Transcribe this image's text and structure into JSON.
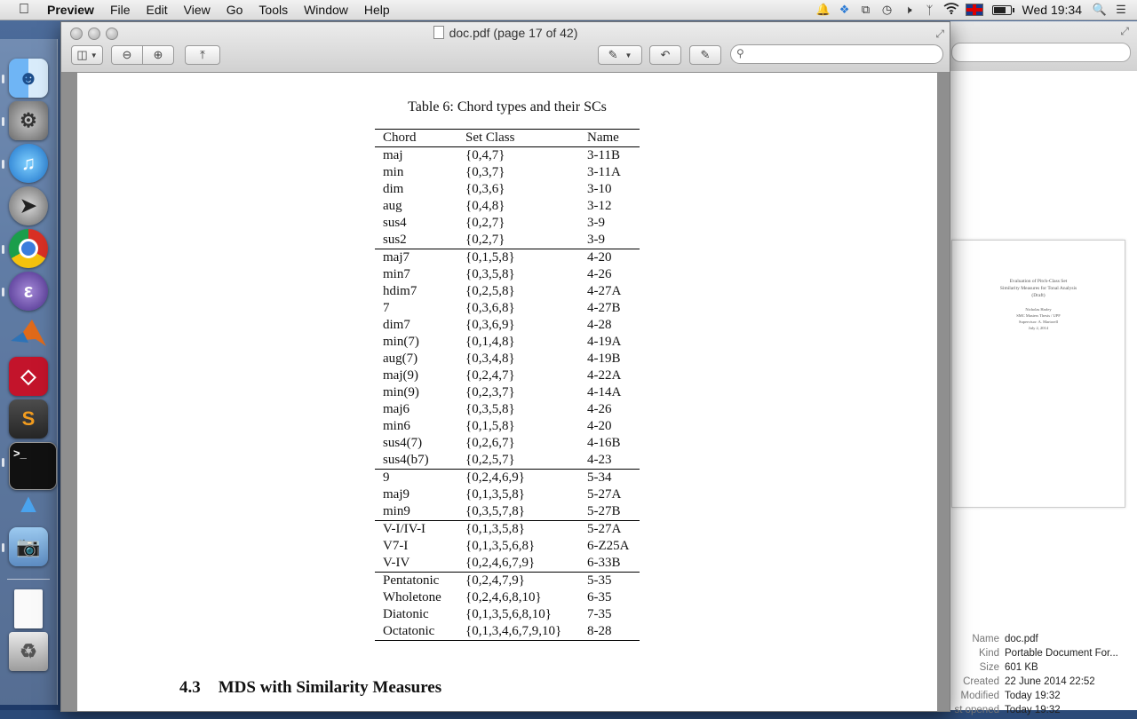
{
  "menubar": {
    "app": "Preview",
    "items": [
      "File",
      "Edit",
      "View",
      "Go",
      "Tools",
      "Window",
      "Help"
    ],
    "clock": "Wed 19:34"
  },
  "window": {
    "title": "doc.pdf (page 17 of 42)"
  },
  "document": {
    "caption": "Table 6: Chord types and their SCs",
    "headers": [
      "Chord",
      "Set Class",
      "Name"
    ],
    "groups": [
      [
        [
          "maj",
          "{0,4,7}",
          "3-11B"
        ],
        [
          "min",
          "{0,3,7}",
          "3-11A"
        ],
        [
          "dim",
          "{0,3,6}",
          "3-10"
        ],
        [
          "aug",
          "{0,4,8}",
          "3-12"
        ],
        [
          "sus4",
          "{0,2,7}",
          "3-9"
        ],
        [
          "sus2",
          "{0,2,7}",
          "3-9"
        ]
      ],
      [
        [
          "maj7",
          "{0,1,5,8}",
          "4-20"
        ],
        [
          "min7",
          "{0,3,5,8}",
          "4-26"
        ],
        [
          "hdim7",
          "{0,2,5,8}",
          "4-27A"
        ],
        [
          "7",
          "{0,3,6,8}",
          "4-27B"
        ],
        [
          "dim7",
          "{0,3,6,9}",
          "4-28"
        ],
        [
          "min(7)",
          "{0,1,4,8}",
          "4-19A"
        ],
        [
          "aug(7)",
          "{0,3,4,8}",
          "4-19B"
        ],
        [
          "maj(9)",
          "{0,2,4,7}",
          "4-22A"
        ],
        [
          "min(9)",
          "{0,2,3,7}",
          "4-14A"
        ],
        [
          "maj6",
          "{0,3,5,8}",
          "4-26"
        ],
        [
          "min6",
          "{0,1,5,8}",
          "4-20"
        ],
        [
          "sus4(7)",
          "{0,2,6,7}",
          "4-16B"
        ],
        [
          "sus4(b7)",
          "{0,2,5,7}",
          "4-23"
        ]
      ],
      [
        [
          "9",
          "{0,2,4,6,9}",
          "5-34"
        ],
        [
          "maj9",
          "{0,1,3,5,8}",
          "5-27A"
        ],
        [
          "min9",
          "{0,3,5,7,8}",
          "5-27B"
        ]
      ],
      [
        [
          "V-I/IV-I",
          "{0,1,3,5,8}",
          "5-27A"
        ],
        [
          "V7-I",
          "{0,1,3,5,6,8}",
          "6-Z25A"
        ],
        [
          "V-IV",
          "{0,2,4,6,7,9}",
          "6-33B"
        ]
      ],
      [
        [
          "Pentatonic",
          "{0,2,4,7,9}",
          "5-35"
        ],
        [
          "Wholetone",
          "{0,2,4,6,8,10}",
          "6-35"
        ],
        [
          "Diatonic",
          "{0,1,3,5,6,8,10}",
          "7-35"
        ],
        [
          "Octatonic",
          "{0,1,3,4,6,7,9,10}",
          "8-28"
        ]
      ]
    ],
    "section_number": "4.3",
    "section_title": "MDS with Similarity Measures"
  },
  "thumbnail": {
    "title_lines": [
      "Evaluation of Pitch-Class Set",
      "Similarity Measures for Tonal Analysis",
      "(Draft)"
    ],
    "author_lines": [
      "Nicholas Harley",
      "SMC Masters Thesis / UPF",
      "Supervisor: A. Martorell",
      "July 2, 2014"
    ]
  },
  "info": [
    {
      "key": "Name",
      "value": "doc.pdf"
    },
    {
      "key": "Kind",
      "value": "Portable Document For..."
    },
    {
      "key": "Size",
      "value": "601 KB"
    },
    {
      "key": "Created",
      "value": "22 June 2014 22:52"
    },
    {
      "key": "Modified",
      "value": "Today 19:32"
    },
    {
      "key": "st opened",
      "value": "Today 19:32"
    }
  ],
  "dock": [
    "finder-icon",
    "system-preferences-icon",
    "itunes-icon",
    "launchpad-icon",
    "chrome-icon",
    "emacs-icon",
    "matlab-icon",
    "mendeley-icon",
    "sublime-text-icon",
    "terminal-icon",
    "keynote-icon",
    "preview-icon",
    "document-stack-icon",
    "trash-icon"
  ]
}
